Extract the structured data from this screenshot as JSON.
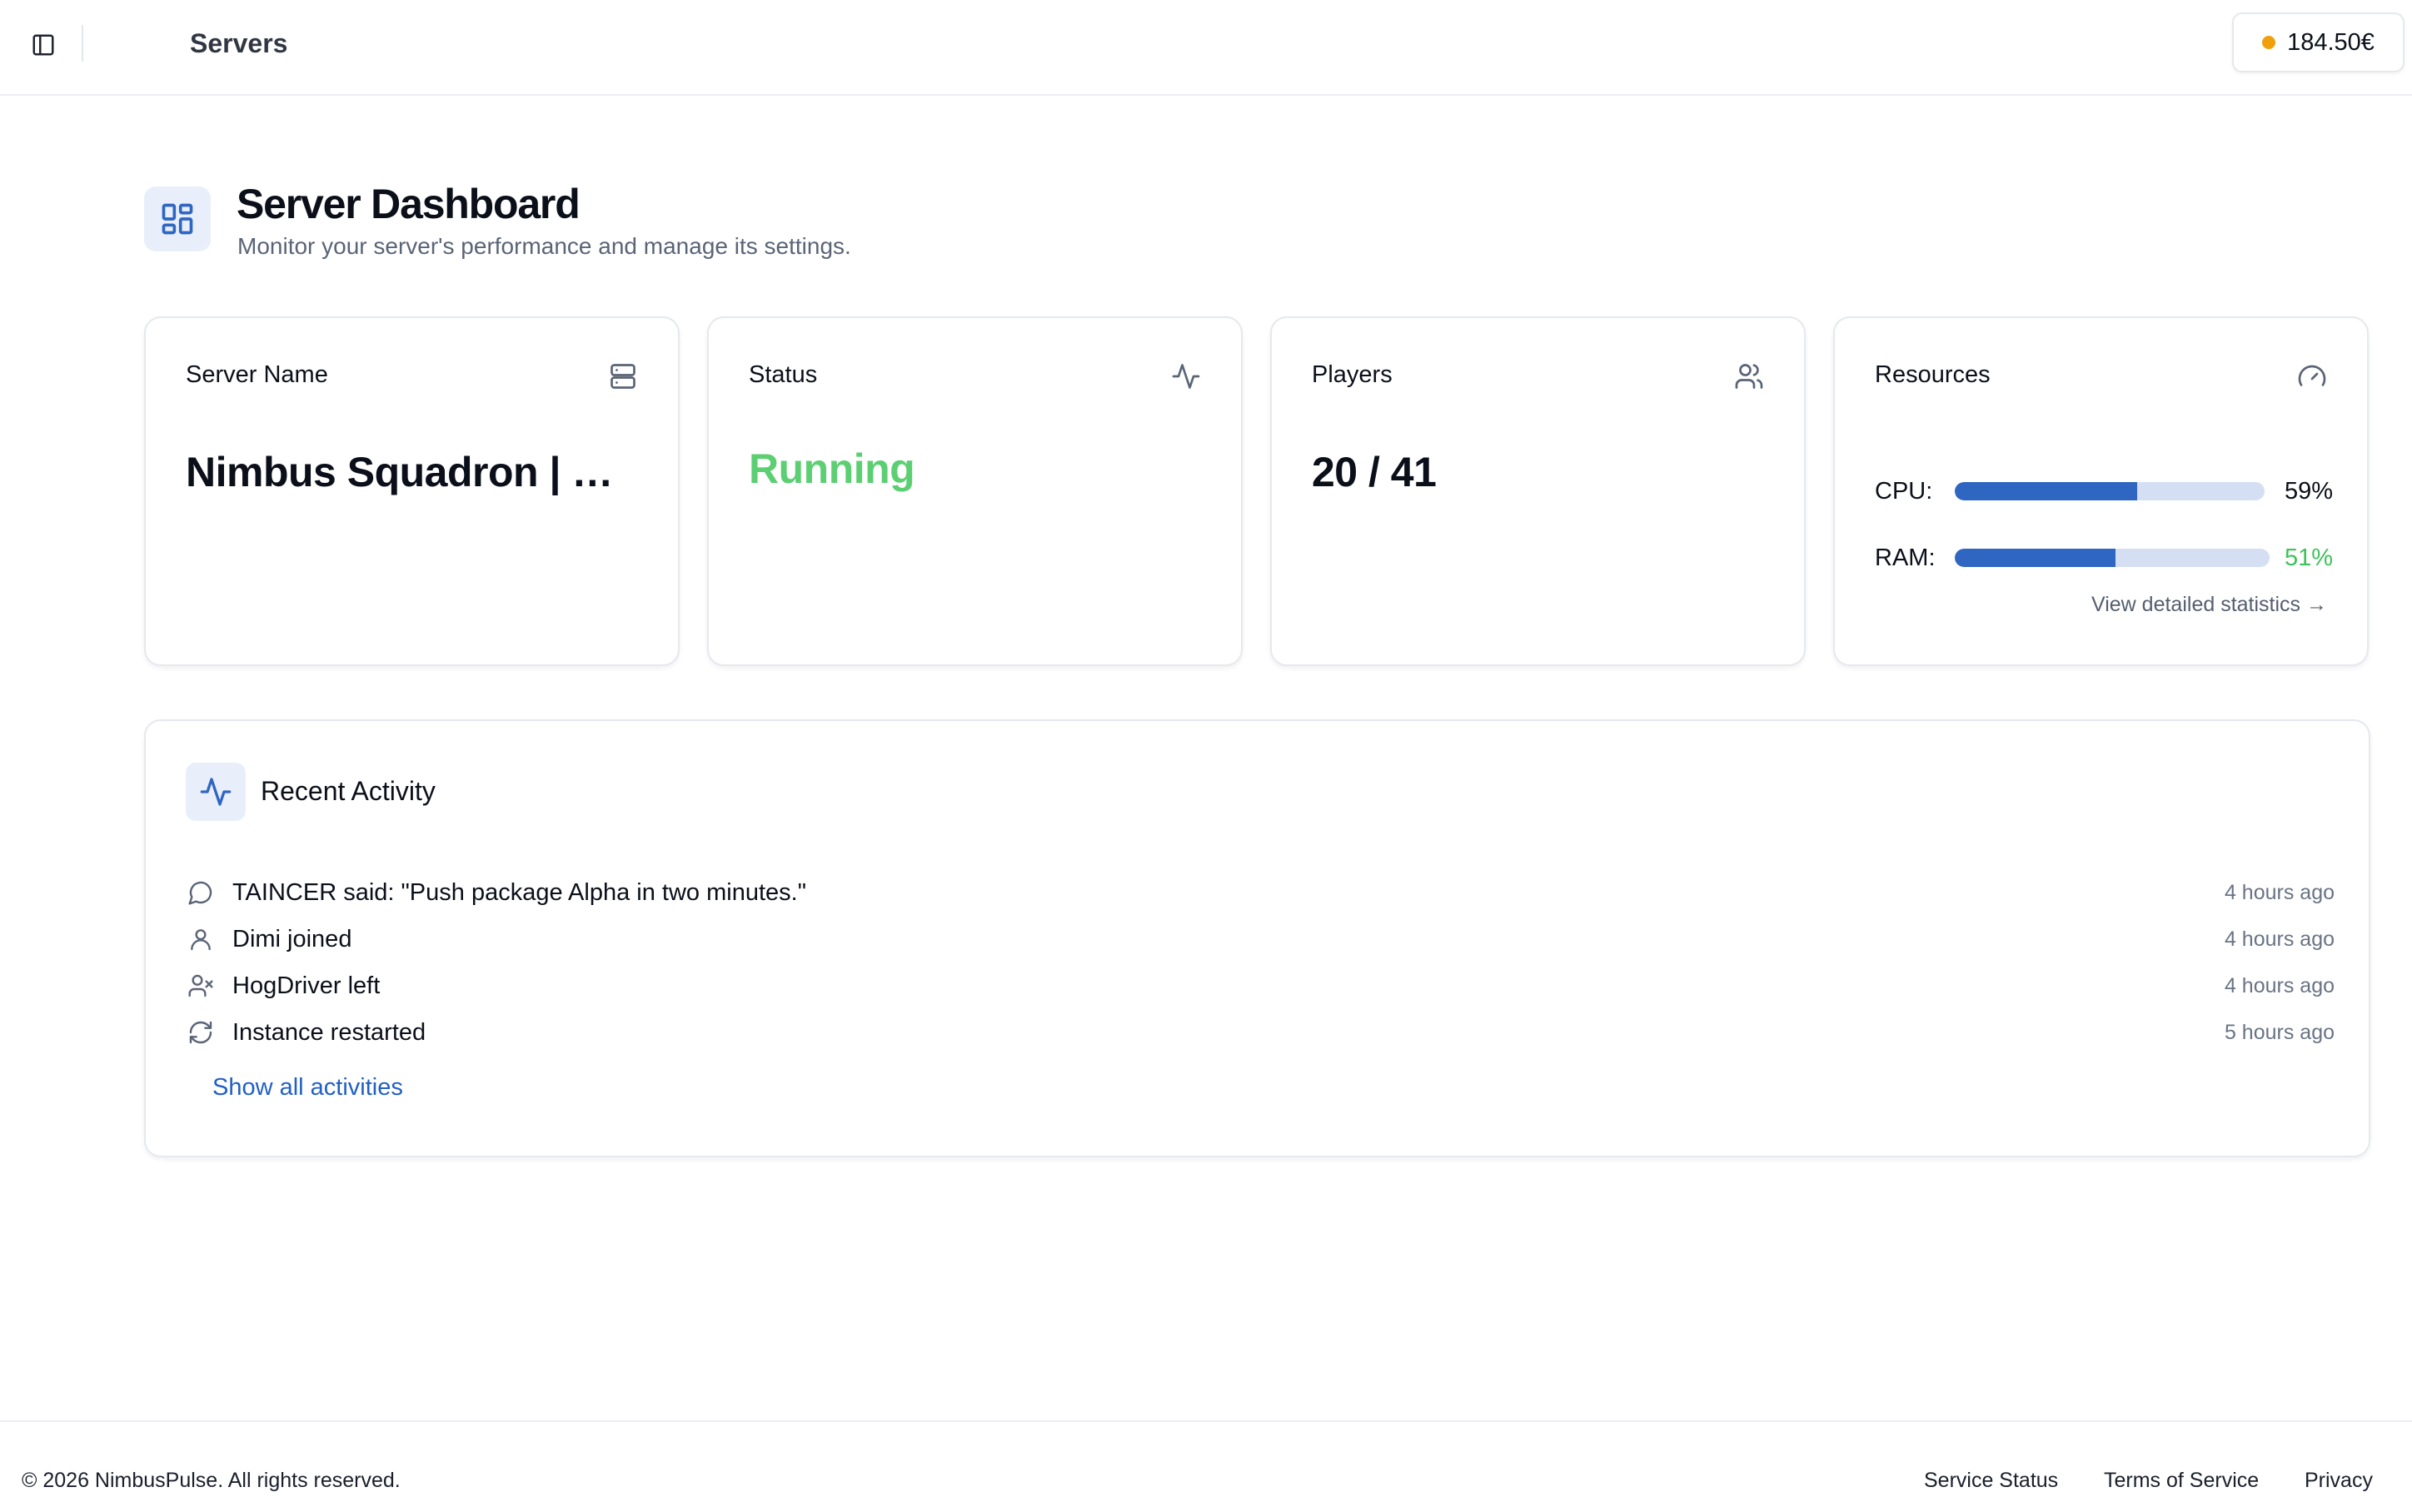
{
  "header": {
    "title": "Servers",
    "balance": "184.50€",
    "balance_dot_color": "#f0a00c",
    "toggle_icon": "sidebar-panel-icon"
  },
  "dashboard": {
    "title": "Server Dashboard",
    "subtitle": "Monitor your server's performance and manage its settings.",
    "icon": "layout-grid-icon"
  },
  "cards": {
    "server_name": {
      "label": "Server Name",
      "value": "Nimbus Squadron | Op...",
      "icon": "server-icon"
    },
    "status": {
      "label": "Status",
      "value": "Running",
      "color": "#5ccf73",
      "icon": "activity-icon"
    },
    "players": {
      "label": "Players",
      "value": "20 / 41",
      "icon": "users-icon"
    },
    "resources": {
      "label": "Resources",
      "icon": "gauge-icon",
      "cpu": {
        "label": "CPU:",
        "percent": 59,
        "text": "59%"
      },
      "ram": {
        "label": "RAM:",
        "percent": 51,
        "text": "51%",
        "color": "#3ec25b"
      },
      "link": "View detailed statistics →"
    }
  },
  "activity": {
    "title": "Recent Activity",
    "icon": "activity-icon",
    "items": [
      {
        "icon": "message-icon",
        "text": "TAINCER said: \"Push package Alpha in two minutes.\"",
        "time": "4 hours ago"
      },
      {
        "icon": "user-icon",
        "text": "Dimi joined",
        "time": "4 hours ago"
      },
      {
        "icon": "user-x-icon",
        "text": "HogDriver left",
        "time": "4 hours ago"
      },
      {
        "icon": "refresh-icon",
        "text": "Instance restarted",
        "time": "5 hours ago"
      }
    ],
    "show_all": "Show all activities"
  },
  "footer": {
    "copyright": "© 2026 NimbusPulse. All rights reserved.",
    "links": [
      "Service Status",
      "Terms of Service",
      "Privacy"
    ]
  },
  "colors": {
    "accent": "#2f66c2",
    "link": "#2160c4",
    "bar_track": "#d5dff3"
  }
}
